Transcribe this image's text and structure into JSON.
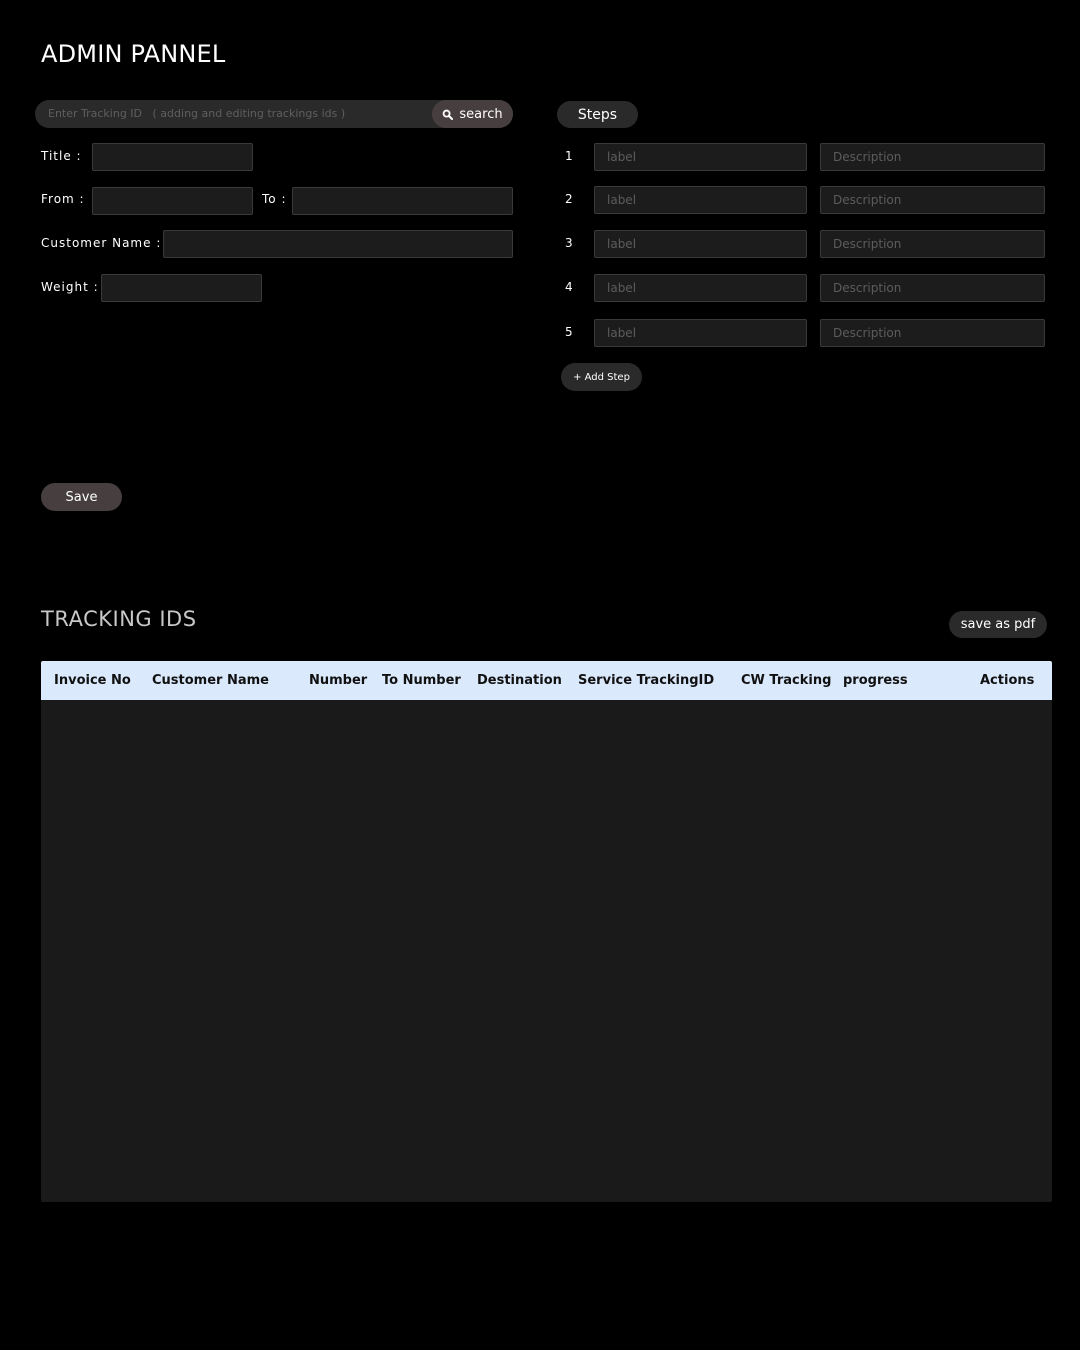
{
  "page_title": "ADMIN PANNEL",
  "search": {
    "placeholder": "Enter Tracking ID   ( adding and editing trackings ids )",
    "button_label": "search",
    "icon": "search-icon"
  },
  "form": {
    "title_label": "Title :",
    "from_label": "From :",
    "to_label": "To :",
    "customer_name_label": "Customer Name :",
    "weight_label": "Weight :"
  },
  "steps": {
    "header": "Steps",
    "label_placeholder": "label",
    "description_placeholder": "Description",
    "items": [
      {
        "number": "1"
      },
      {
        "number": "2"
      },
      {
        "number": "3"
      },
      {
        "number": "4"
      },
      {
        "number": "5"
      }
    ],
    "add_step_label": "+ Add Step"
  },
  "save_label": "Save",
  "tracking": {
    "title": "TRACKING IDS",
    "save_pdf_label": "save as pdf",
    "columns": [
      "Invoice No",
      "Customer Name",
      "Number",
      "To Number",
      "Destination",
      "Service TrackingID",
      "CW Tracking",
      "progress",
      "Actions"
    ],
    "rows": []
  },
  "colors": {
    "background": "#000000",
    "accent_button": "#473f3f",
    "table_header": "#dbe9fd",
    "table_body": "#1a1a1a"
  }
}
